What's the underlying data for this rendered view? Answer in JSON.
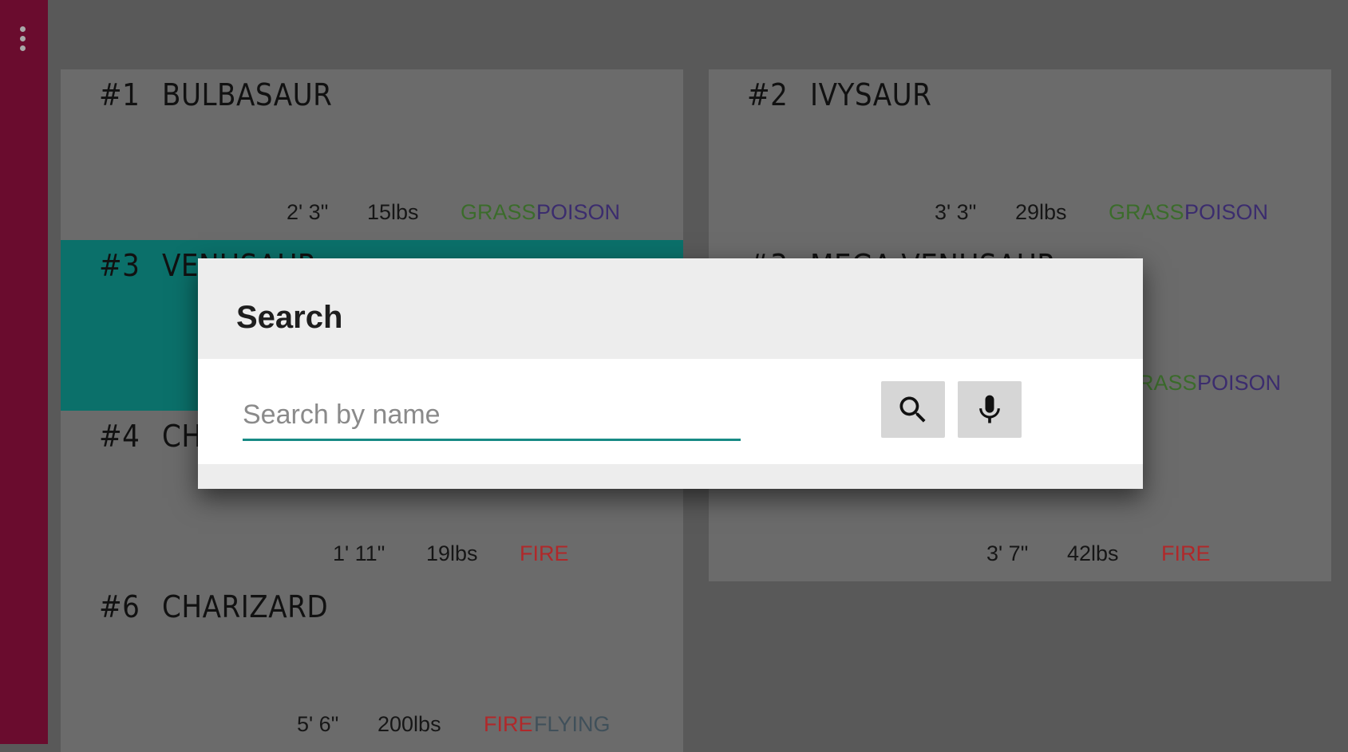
{
  "pokemon": [
    {
      "num": "#1",
      "name": "BULBASAUR",
      "height": "2' 3\"",
      "weight": "15lbs",
      "types": [
        "GRASS",
        "POISON"
      ]
    },
    {
      "num": "#2",
      "name": "IVYSAUR",
      "height": "3' 3\"",
      "weight": "29lbs",
      "types": [
        "GRASS",
        "POISON"
      ]
    },
    {
      "num": "#3",
      "name": "VENUSAUR"
    },
    {
      "num": "#3",
      "name": "MEGA VENUSAUR",
      "types": [
        "GRASS",
        "POISON"
      ]
    },
    {
      "num": "#4",
      "name": "CH",
      "height": "1' 11\"",
      "weight": "19lbs",
      "types": [
        "FIRE"
      ]
    },
    {
      "height": "3' 7\"",
      "weight": "42lbs",
      "types": [
        "FIRE"
      ]
    },
    {
      "num": "#6",
      "name": "CHARIZARD",
      "height": "5' 6\"",
      "weight": "200lbs",
      "types": [
        "FIRE",
        "FLYING"
      ]
    }
  ],
  "dialog": {
    "title": "Search",
    "input_value": "",
    "input_placeholder": "Search by name",
    "search_icon": "search-icon",
    "mic_icon": "microphone-icon"
  },
  "sidebar": {
    "menu_icon": "more-vert-icon"
  },
  "colors": {
    "sidebar": "#6a0c2e",
    "selected_card": "#0b706a",
    "accent": "#178a85",
    "grass": "#3b6c2b",
    "poison": "#3b2c6e",
    "fire": "#b0282a",
    "flying": "#40505a"
  }
}
